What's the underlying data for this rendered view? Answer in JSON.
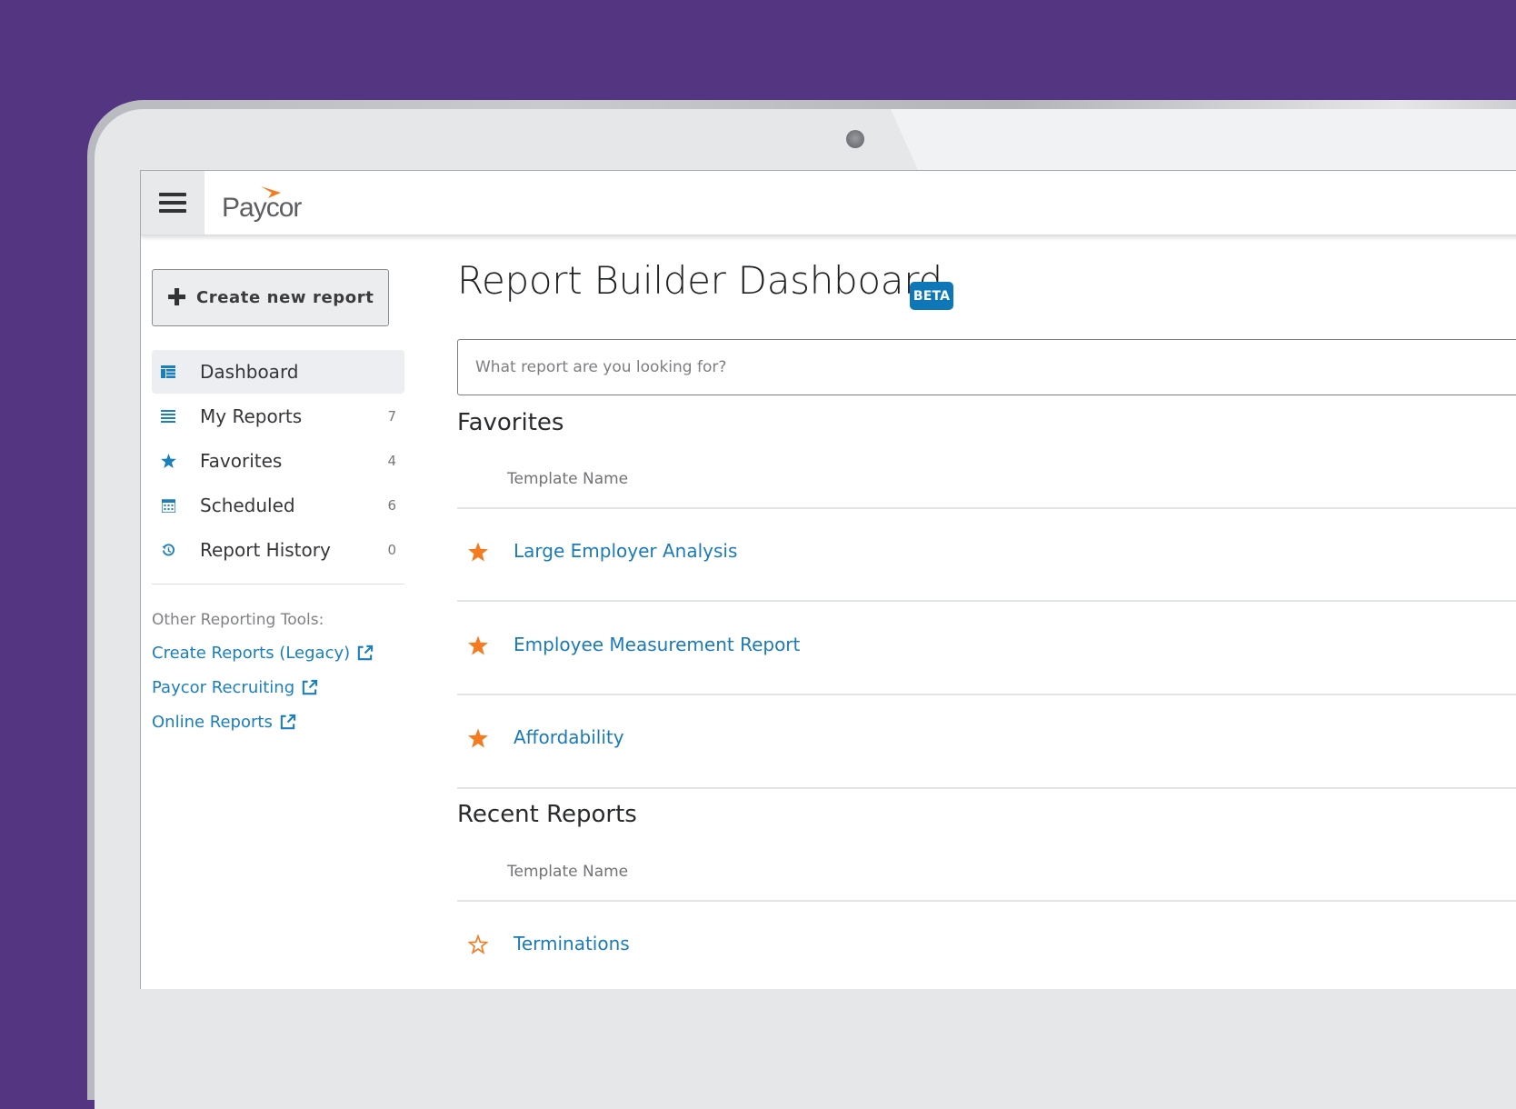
{
  "app": {
    "brand": "Paycor",
    "colors": {
      "background": "#533581",
      "accent_blue": "#1a7fba",
      "beta_badge": "#0d77b8",
      "star_orange": "#f47b20"
    }
  },
  "header": {
    "menu_icon": "hamburger-icon",
    "logo_text": "Paycor"
  },
  "sidebar": {
    "create_button": {
      "icon": "plus-icon",
      "label": "Create new report"
    },
    "items": [
      {
        "icon": "dashboard-icon",
        "label": "Dashboard",
        "count": "",
        "active": true
      },
      {
        "icon": "list-icon",
        "label": "My Reports",
        "count": "7"
      },
      {
        "icon": "star-icon",
        "label": "Favorites",
        "count": "4"
      },
      {
        "icon": "calendar-icon",
        "label": "Scheduled",
        "count": "6"
      },
      {
        "icon": "history-icon",
        "label": "Report History",
        "count": "0"
      }
    ],
    "other_tools_label": "Other Reporting Tools:",
    "links": [
      {
        "label": "Create Reports (Legacy)",
        "icon": "external-link-icon"
      },
      {
        "label": "Paycor Recruiting",
        "icon": "external-link-icon"
      },
      {
        "label": "Online Reports",
        "icon": "external-link-icon"
      }
    ]
  },
  "main": {
    "title": "Report Builder Dashboard",
    "badge": "BETA",
    "search": {
      "placeholder": "What report are you looking for?",
      "value": ""
    },
    "favorites": {
      "title": "Favorites",
      "column_header": "Template Name",
      "rows": [
        {
          "name": "Large Employer Analysis",
          "favorited": true
        },
        {
          "name": "Employee Measurement Report",
          "favorited": true
        },
        {
          "name": "Affordability",
          "favorited": true
        }
      ]
    },
    "recent": {
      "title": "Recent Reports",
      "column_header": "Template Name",
      "rows": [
        {
          "name": "Terminations",
          "favorited": false
        }
      ]
    }
  }
}
